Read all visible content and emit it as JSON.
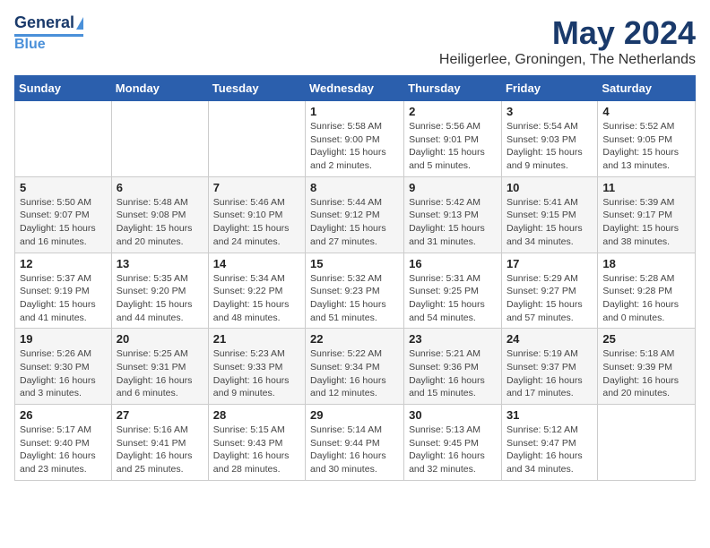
{
  "logo": {
    "line1": "General",
    "line2": "Blue"
  },
  "title": "May 2024",
  "location": "Heiligerlee, Groningen, The Netherlands",
  "headers": [
    "Sunday",
    "Monday",
    "Tuesday",
    "Wednesday",
    "Thursday",
    "Friday",
    "Saturday"
  ],
  "weeks": [
    [
      {
        "day": "",
        "info": ""
      },
      {
        "day": "",
        "info": ""
      },
      {
        "day": "",
        "info": ""
      },
      {
        "day": "1",
        "info": "Sunrise: 5:58 AM\nSunset: 9:00 PM\nDaylight: 15 hours\nand 2 minutes."
      },
      {
        "day": "2",
        "info": "Sunrise: 5:56 AM\nSunset: 9:01 PM\nDaylight: 15 hours\nand 5 minutes."
      },
      {
        "day": "3",
        "info": "Sunrise: 5:54 AM\nSunset: 9:03 PM\nDaylight: 15 hours\nand 9 minutes."
      },
      {
        "day": "4",
        "info": "Sunrise: 5:52 AM\nSunset: 9:05 PM\nDaylight: 15 hours\nand 13 minutes."
      }
    ],
    [
      {
        "day": "5",
        "info": "Sunrise: 5:50 AM\nSunset: 9:07 PM\nDaylight: 15 hours\nand 16 minutes."
      },
      {
        "day": "6",
        "info": "Sunrise: 5:48 AM\nSunset: 9:08 PM\nDaylight: 15 hours\nand 20 minutes."
      },
      {
        "day": "7",
        "info": "Sunrise: 5:46 AM\nSunset: 9:10 PM\nDaylight: 15 hours\nand 24 minutes."
      },
      {
        "day": "8",
        "info": "Sunrise: 5:44 AM\nSunset: 9:12 PM\nDaylight: 15 hours\nand 27 minutes."
      },
      {
        "day": "9",
        "info": "Sunrise: 5:42 AM\nSunset: 9:13 PM\nDaylight: 15 hours\nand 31 minutes."
      },
      {
        "day": "10",
        "info": "Sunrise: 5:41 AM\nSunset: 9:15 PM\nDaylight: 15 hours\nand 34 minutes."
      },
      {
        "day": "11",
        "info": "Sunrise: 5:39 AM\nSunset: 9:17 PM\nDaylight: 15 hours\nand 38 minutes."
      }
    ],
    [
      {
        "day": "12",
        "info": "Sunrise: 5:37 AM\nSunset: 9:19 PM\nDaylight: 15 hours\nand 41 minutes."
      },
      {
        "day": "13",
        "info": "Sunrise: 5:35 AM\nSunset: 9:20 PM\nDaylight: 15 hours\nand 44 minutes."
      },
      {
        "day": "14",
        "info": "Sunrise: 5:34 AM\nSunset: 9:22 PM\nDaylight: 15 hours\nand 48 minutes."
      },
      {
        "day": "15",
        "info": "Sunrise: 5:32 AM\nSunset: 9:23 PM\nDaylight: 15 hours\nand 51 minutes."
      },
      {
        "day": "16",
        "info": "Sunrise: 5:31 AM\nSunset: 9:25 PM\nDaylight: 15 hours\nand 54 minutes."
      },
      {
        "day": "17",
        "info": "Sunrise: 5:29 AM\nSunset: 9:27 PM\nDaylight: 15 hours\nand 57 minutes."
      },
      {
        "day": "18",
        "info": "Sunrise: 5:28 AM\nSunset: 9:28 PM\nDaylight: 16 hours\nand 0 minutes."
      }
    ],
    [
      {
        "day": "19",
        "info": "Sunrise: 5:26 AM\nSunset: 9:30 PM\nDaylight: 16 hours\nand 3 minutes."
      },
      {
        "day": "20",
        "info": "Sunrise: 5:25 AM\nSunset: 9:31 PM\nDaylight: 16 hours\nand 6 minutes."
      },
      {
        "day": "21",
        "info": "Sunrise: 5:23 AM\nSunset: 9:33 PM\nDaylight: 16 hours\nand 9 minutes."
      },
      {
        "day": "22",
        "info": "Sunrise: 5:22 AM\nSunset: 9:34 PM\nDaylight: 16 hours\nand 12 minutes."
      },
      {
        "day": "23",
        "info": "Sunrise: 5:21 AM\nSunset: 9:36 PM\nDaylight: 16 hours\nand 15 minutes."
      },
      {
        "day": "24",
        "info": "Sunrise: 5:19 AM\nSunset: 9:37 PM\nDaylight: 16 hours\nand 17 minutes."
      },
      {
        "day": "25",
        "info": "Sunrise: 5:18 AM\nSunset: 9:39 PM\nDaylight: 16 hours\nand 20 minutes."
      }
    ],
    [
      {
        "day": "26",
        "info": "Sunrise: 5:17 AM\nSunset: 9:40 PM\nDaylight: 16 hours\nand 23 minutes."
      },
      {
        "day": "27",
        "info": "Sunrise: 5:16 AM\nSunset: 9:41 PM\nDaylight: 16 hours\nand 25 minutes."
      },
      {
        "day": "28",
        "info": "Sunrise: 5:15 AM\nSunset: 9:43 PM\nDaylight: 16 hours\nand 28 minutes."
      },
      {
        "day": "29",
        "info": "Sunrise: 5:14 AM\nSunset: 9:44 PM\nDaylight: 16 hours\nand 30 minutes."
      },
      {
        "day": "30",
        "info": "Sunrise: 5:13 AM\nSunset: 9:45 PM\nDaylight: 16 hours\nand 32 minutes."
      },
      {
        "day": "31",
        "info": "Sunrise: 5:12 AM\nSunset: 9:47 PM\nDaylight: 16 hours\nand 34 minutes."
      },
      {
        "day": "",
        "info": ""
      }
    ]
  ]
}
